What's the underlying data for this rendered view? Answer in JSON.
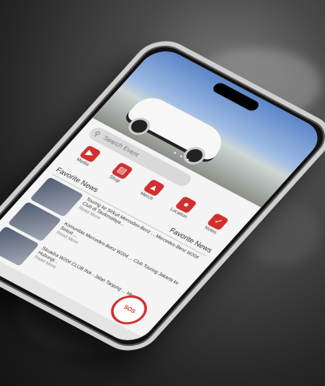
{
  "hero": {
    "dots": "• • •"
  },
  "search": {
    "placeholder": "Search Event"
  },
  "menu": [
    {
      "label": "Media",
      "icon": "play-icon"
    },
    {
      "label": "Shop",
      "icon": "bag-icon"
    },
    {
      "label": "Merch",
      "icon": "shirt-icon"
    },
    {
      "label": "Location",
      "icon": "pin-icon"
    },
    {
      "label": "Notes",
      "icon": "check-icon"
    }
  ],
  "tabs": {
    "left": "Favorite News",
    "right": "Favorite News"
  },
  "news": [
    {
      "text": "Touring ke Sirkuit Mercedes-Benz ... Mercedes-Benz W204 Club di Tasikmalaya...",
      "more": "Read More"
    },
    {
      "text": "Komunitas Mercedes-Benz W204 ... Club Touring Jakarta ke Sirkuit ...",
      "more": "Read More"
    },
    {
      "text": "Skuadra W204 CLUB INA - Jalan Tanjung ... Memilih Hubungi...",
      "more": "Read More"
    }
  ],
  "sos": {
    "label": "SOS"
  },
  "colors": {
    "accent": "#d32f2f"
  }
}
